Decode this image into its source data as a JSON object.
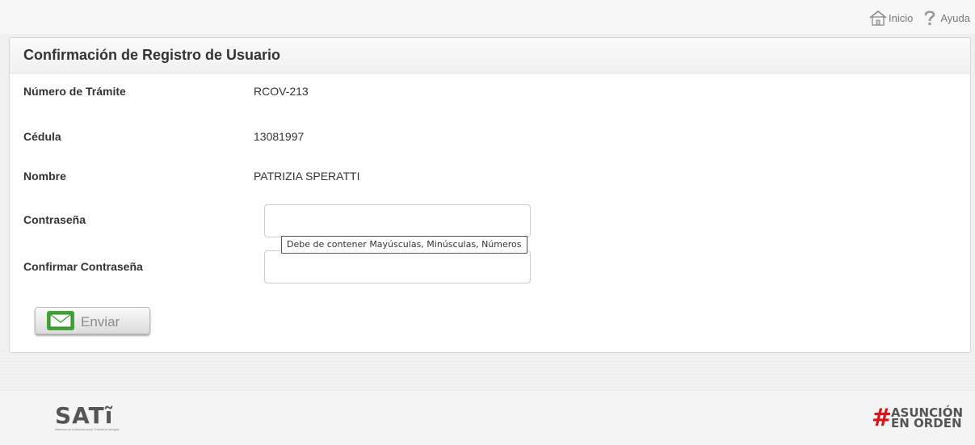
{
  "topnav": {
    "home_label": "Inicio",
    "help_label": "Ayuda",
    "home_icon": "home-icon",
    "help_icon": "question-icon"
  },
  "panel": {
    "title": "Confirmación de Registro de Usuario"
  },
  "form": {
    "tramite": {
      "label": "Número de Trámite",
      "value": "RCOV-213"
    },
    "cedula": {
      "label": "Cédula",
      "value": "13081997"
    },
    "nombre": {
      "label": "Nombre",
      "value": "PATRIZIA SPERATTI"
    },
    "password": {
      "label": "Contraseña",
      "value": "",
      "tooltip": "Debe de contener Mayúsculas, Minúsculas, Números"
    },
    "confirm_password": {
      "label": "Confirmar Contraseña",
      "value": ""
    },
    "submit_label": "Enviar",
    "submit_icon": "envelope-icon"
  },
  "footer": {
    "left_logo": "SATĩ",
    "left_logo_sub": "Sistema de Administración Tributaria Integral",
    "right_logo_hash": "#",
    "right_logo_line1": "ASUNCIÓN",
    "right_logo_line2": "EN ORDEN"
  },
  "colors": {
    "accent_green": "#3fa535",
    "brand_red": "#d7141a"
  }
}
